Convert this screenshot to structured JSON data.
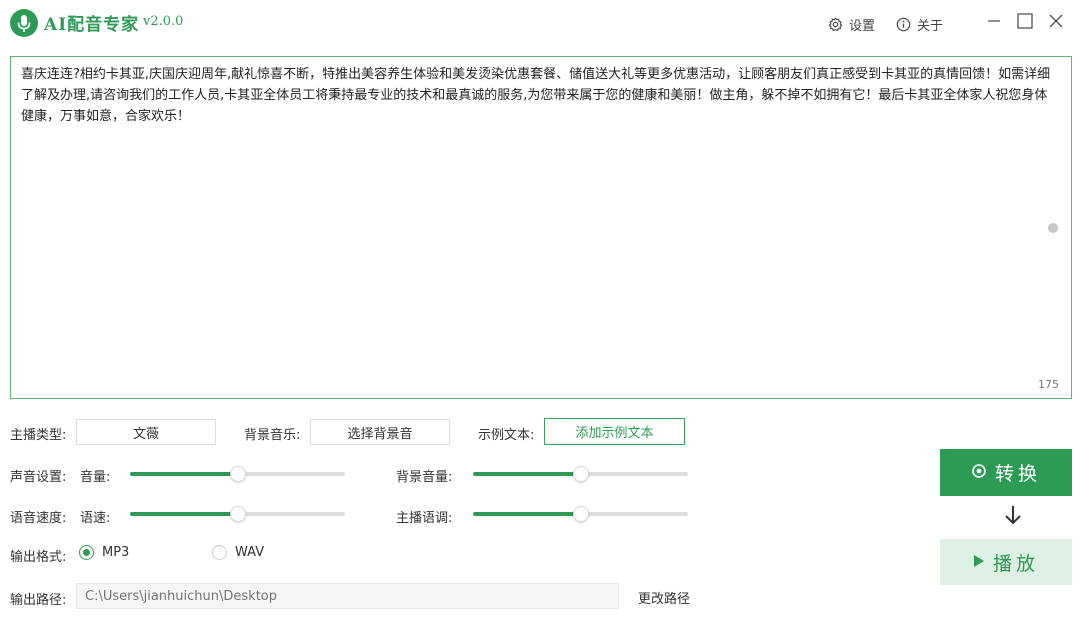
{
  "app": {
    "title": "AI配音专家",
    "version": "v2.0.0",
    "settings_label": "设置",
    "about_label": "关于"
  },
  "editor": {
    "text": "喜庆连连?相约卡其亚,庆国庆迎周年,献礼惊喜不断，特推出美容养生体验和美发烫染优惠套餐、储值送大礼等更多优惠活动，让顾客朋友们真正感受到卡其亚的真情回馈！如需详细了解及办理,请咨询我们的工作人员,卡其亚全体员工将秉持最专业的技术和最真诚的服务,为您带来属于您的健康和美丽！做主角，躲不掉不如拥有它！最后卡其亚全体家人祝您身体健康，万事如意，合家欢乐！",
    "char_count": "175"
  },
  "controls": {
    "anchor_type_label": "主播类型:",
    "anchor_type_value": "文薇",
    "bg_music_label": "背景音乐:",
    "bg_music_value": "选择背景音",
    "sample_text_label": "示例文本:",
    "sample_text_button": "添加示例文本",
    "voice_settings_label": "声音设置:",
    "volume_label": "音量:",
    "bg_volume_label": "背景音量:",
    "speed_settings_label": "语音速度:",
    "speed_label": "语速:",
    "pitch_label": "主播语调:",
    "sliders": {
      "volume": 0.5,
      "bg_volume": 0.5,
      "speed": 0.5,
      "pitch": 0.5
    },
    "output_format_label": "输出格式:",
    "format_options": [
      "MP3",
      "WAV"
    ],
    "format_selected": "MP3",
    "output_path_label": "输出路径:",
    "output_path_placeholder": "C:\\Users\\jianhuichun\\Desktop",
    "change_path_label": "更改路径"
  },
  "actions": {
    "convert_label": "转换",
    "play_label": "播放"
  },
  "colors": {
    "accent": "#2e9b55",
    "play_bg": "#ddf0e3"
  }
}
